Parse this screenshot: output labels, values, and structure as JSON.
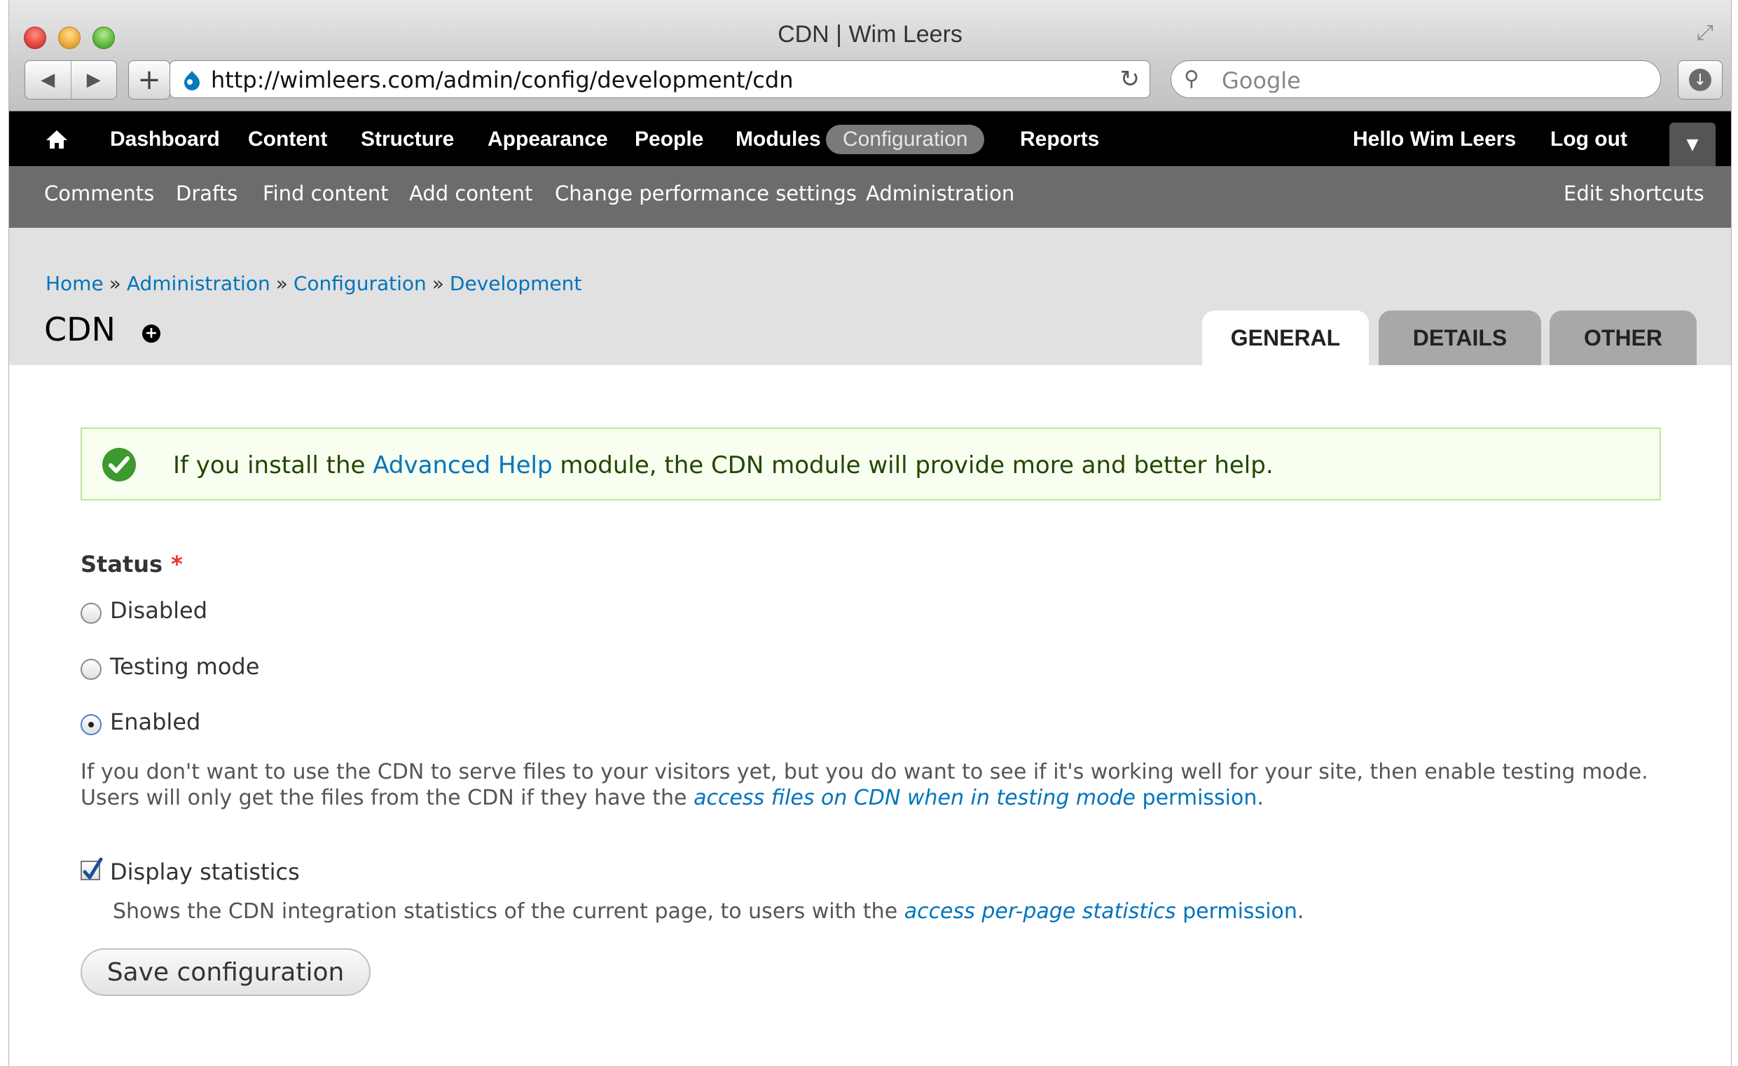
{
  "browser": {
    "window_title": "CDN | Wim Leers",
    "url": "http://wimleers.com/admin/config/development/cdn",
    "search_placeholder": "Google",
    "nav_back": "◀",
    "nav_forward": "▶",
    "new_tab": "+",
    "reload": "↻"
  },
  "toolbar": {
    "menu": [
      "Dashboard",
      "Content",
      "Structure",
      "Appearance",
      "People",
      "Modules",
      "Configuration",
      "Reports"
    ],
    "active_item": "Configuration",
    "greeting_prefix": "Hello ",
    "user_name": "Wim Leers",
    "logout": "Log out",
    "shortcuts": [
      "Comments",
      "Drafts",
      "Find content",
      "Add content",
      "Change performance settings",
      "Administration"
    ],
    "edit_shortcuts": "Edit shortcuts"
  },
  "breadcrumb": [
    "Home",
    "Administration",
    "Configuration",
    "Development"
  ],
  "breadcrumb_separator": "»",
  "page": {
    "title": "CDN",
    "tabs": [
      "GENERAL",
      "DETAILS",
      "OTHER"
    ],
    "active_tab": "GENERAL"
  },
  "message": {
    "prefix": "If you install the ",
    "link": "Advanced Help",
    "suffix": " module, the CDN module will provide more and better help."
  },
  "form": {
    "status_label": "Status",
    "required_marker": "*",
    "options": [
      "Disabled",
      "Testing mode",
      "Enabled"
    ],
    "selected_option": "Enabled",
    "status_description_line1": "If you don't want to use the CDN to serve files to your visitors yet, but you do want to see if it's working well for your site, then enable testing mode.",
    "status_description_line2_prefix": "Users will only get the files from the CDN if they have the ",
    "status_description_link_italic": "access files on CDN when in testing mode",
    "status_description_link_tail": " permission",
    "status_description_end": ".",
    "stats_label": "Display statistics",
    "stats_checked": true,
    "stats_description_prefix": "Shows the CDN integration statistics of the current page, to users with the ",
    "stats_description_link_italic": "access per-page statistics",
    "stats_description_link_tail": " permission",
    "stats_description_end": ".",
    "save_button": "Save configuration"
  },
  "colors": {
    "link": "#0074bd",
    "toolbar_bg": "#000000",
    "shortcuts_bg": "#6c6c6c",
    "message_bg": "#f8fff0",
    "message_border": "#bee59f",
    "required": "#ee3333"
  },
  "icons": [
    "close-window-icon",
    "minimize-window-icon",
    "zoom-window-icon",
    "fullscreen-icon",
    "back-icon",
    "forward-icon",
    "drupal-icon",
    "reload-icon",
    "search-icon",
    "downloads-icon",
    "home-icon",
    "chevron-down-icon",
    "add-shortcut-icon",
    "check-circle-icon",
    "checkmark-icon"
  ]
}
